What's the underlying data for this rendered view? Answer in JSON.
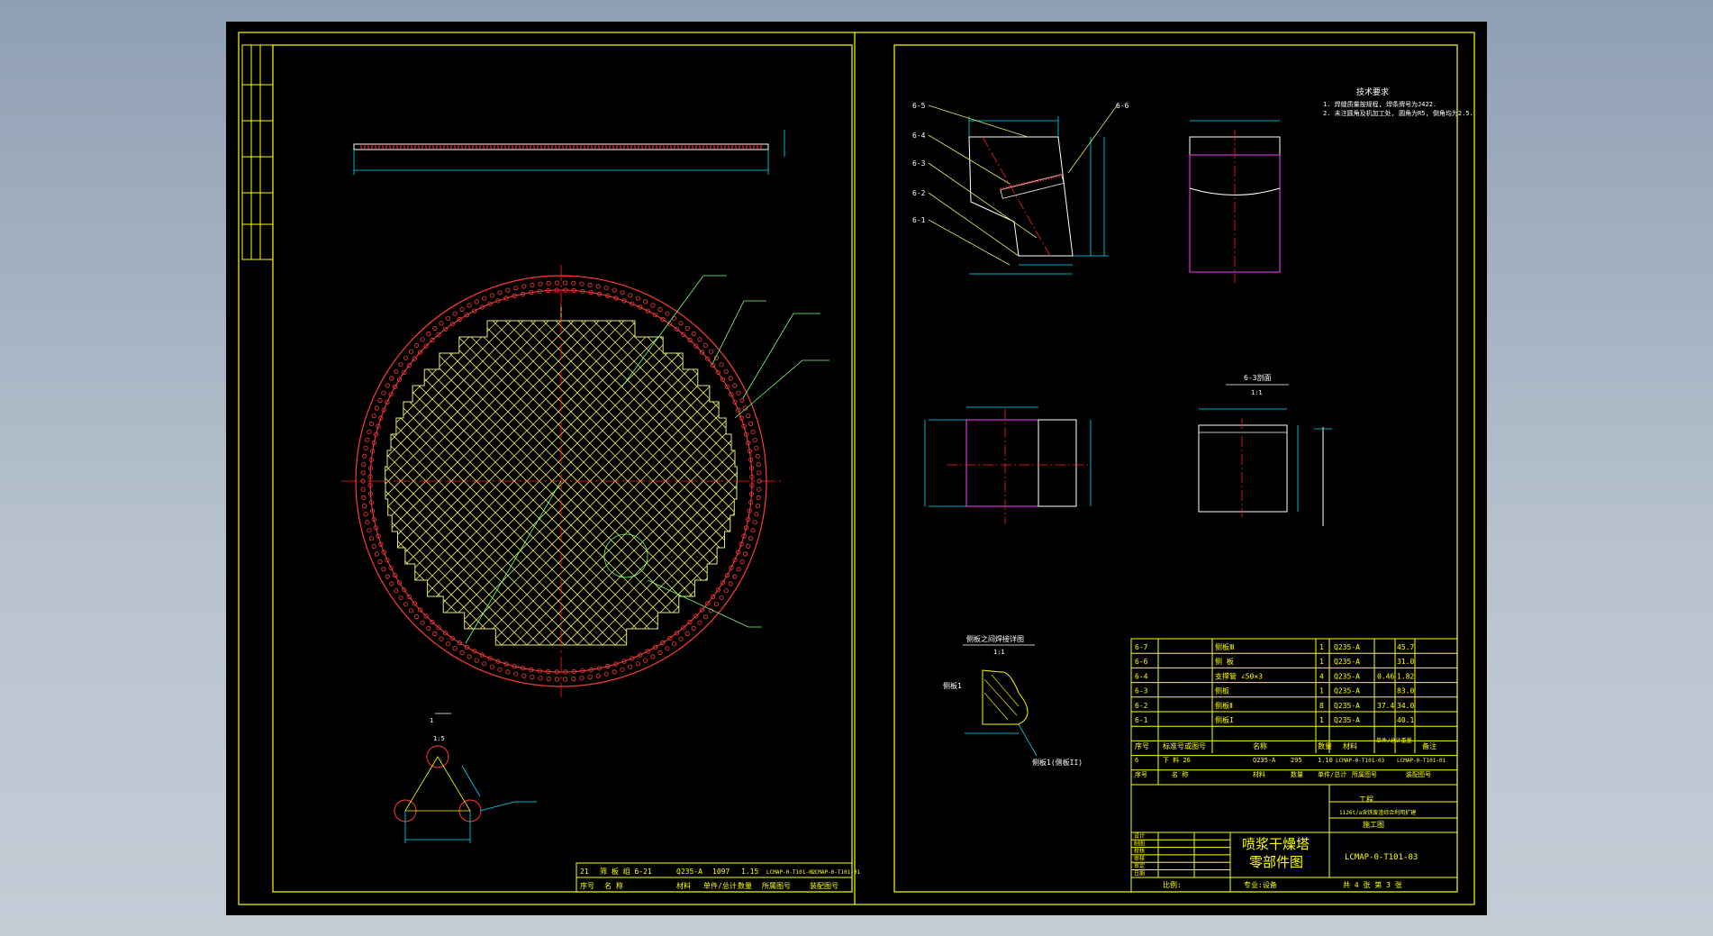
{
  "colors": {
    "frame": "#ffff00",
    "dimension": "#00e0ff",
    "center_line": "#ff2020",
    "holes": "#ff3b3b",
    "mesh": "#e6e66a",
    "leader": "#7cff7c",
    "outline": "#ffffff",
    "part": "#ff40ff"
  },
  "left_sheet": {
    "hole_label": "1",
    "detail_scale": "1:5",
    "title_row": {
      "idx": "21",
      "name": "筛 板 组 6-21",
      "material": "Q235-A",
      "qty": "1097",
      "weight": "1.15",
      "drawing": "LCMAP-0-T101-02",
      "ref": "LCMAP-0-T101-01"
    },
    "header_row": [
      "序号",
      "名 称",
      "材料",
      "单件/总计",
      "数量",
      "所属图号",
      "装配图号"
    ]
  },
  "right_sheet": {
    "tech_title": "技术要求",
    "tech_notes": [
      "1. 焊缝质量按规程, 焊条牌号为J422.",
      "2. 未注圆角及机加工处, 圆角为R5, 倒角均为2.5."
    ],
    "callouts": [
      "6-5",
      "6-4",
      "6-3",
      "6-2",
      "6-1",
      "6-6"
    ],
    "section_label": "6-3剖面",
    "section_scale": "1:1",
    "detail_title": "侧板之间焊接详图",
    "detail_scale": "1:1",
    "detail_labels": [
      "侧板1",
      "侧板1(侧板II)"
    ],
    "bom_rows": [
      [
        "6-7",
        "侧板Ⅲ",
        "1",
        "Q235-A",
        "",
        "45.7"
      ],
      [
        "6-6",
        "侧 板",
        "1",
        "Q235-A",
        "",
        "31.0"
      ],
      [
        "6-4",
        "支撑管 ∠50×3",
        "4",
        "Q235-A",
        "0.46",
        "1.82"
      ],
      [
        "6-3",
        "侧板",
        "1",
        "Q235-A",
        "",
        "83.0"
      ],
      [
        "6-2",
        "侧板Ⅱ",
        "8",
        "Q235-A",
        "37.4",
        "34.0"
      ],
      [
        "6-1",
        "侧板I",
        "1",
        "Q235-A",
        "",
        "40.1"
      ]
    ],
    "bom_header": [
      "序号",
      "标准号或图号",
      "名称",
      "数量",
      "材料",
      "单件/总计重量",
      "备注"
    ],
    "assembly_row": [
      "6",
      "下 料 26",
      "Q235-A",
      "295",
      "1.10",
      "LCMAP-0-T101-03",
      "LCMAP-0-T101-01"
    ],
    "assembly_header": [
      "序号",
      "名 称",
      "材料",
      "数量",
      "单件/总计",
      "所属图号",
      "装配图号"
    ],
    "company": "工程",
    "project_name": "1126t/a含铁废渣综合利用扩建",
    "design_stage": "施工图",
    "drawing_title_1": "喷浆干燥塔",
    "drawing_title_2": "零部件图",
    "drawing_number": "LCMAP-0-T101-03",
    "footer": {
      "scale": "比例:",
      "discipline": "专业:设备",
      "sheet": "共 4 张 第 3 张"
    },
    "signature_labels": [
      "设计",
      "制图",
      "校核",
      "审核",
      "审定",
      "日期"
    ]
  }
}
